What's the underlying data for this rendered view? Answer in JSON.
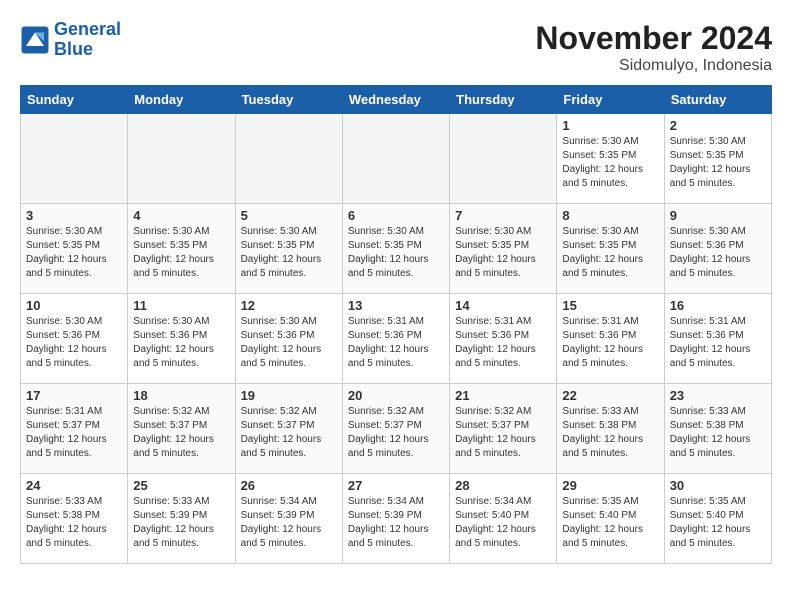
{
  "logo": {
    "line1": "General",
    "line2": "Blue"
  },
  "title": "November 2024",
  "subtitle": "Sidomulyo, Indonesia",
  "days_of_week": [
    "Sunday",
    "Monday",
    "Tuesday",
    "Wednesday",
    "Thursday",
    "Friday",
    "Saturday"
  ],
  "weeks": [
    [
      {
        "day": "",
        "empty": true
      },
      {
        "day": "",
        "empty": true
      },
      {
        "day": "",
        "empty": true
      },
      {
        "day": "",
        "empty": true
      },
      {
        "day": "",
        "empty": true
      },
      {
        "day": "1",
        "sunrise": "Sunrise: 5:30 AM",
        "sunset": "Sunset: 5:35 PM",
        "daylight": "Daylight: 12 hours and 5 minutes."
      },
      {
        "day": "2",
        "sunrise": "Sunrise: 5:30 AM",
        "sunset": "Sunset: 5:35 PM",
        "daylight": "Daylight: 12 hours and 5 minutes."
      }
    ],
    [
      {
        "day": "3",
        "sunrise": "Sunrise: 5:30 AM",
        "sunset": "Sunset: 5:35 PM",
        "daylight": "Daylight: 12 hours and 5 minutes."
      },
      {
        "day": "4",
        "sunrise": "Sunrise: 5:30 AM",
        "sunset": "Sunset: 5:35 PM",
        "daylight": "Daylight: 12 hours and 5 minutes."
      },
      {
        "day": "5",
        "sunrise": "Sunrise: 5:30 AM",
        "sunset": "Sunset: 5:35 PM",
        "daylight": "Daylight: 12 hours and 5 minutes."
      },
      {
        "day": "6",
        "sunrise": "Sunrise: 5:30 AM",
        "sunset": "Sunset: 5:35 PM",
        "daylight": "Daylight: 12 hours and 5 minutes."
      },
      {
        "day": "7",
        "sunrise": "Sunrise: 5:30 AM",
        "sunset": "Sunset: 5:35 PM",
        "daylight": "Daylight: 12 hours and 5 minutes."
      },
      {
        "day": "8",
        "sunrise": "Sunrise: 5:30 AM",
        "sunset": "Sunset: 5:35 PM",
        "daylight": "Daylight: 12 hours and 5 minutes."
      },
      {
        "day": "9",
        "sunrise": "Sunrise: 5:30 AM",
        "sunset": "Sunset: 5:36 PM",
        "daylight": "Daylight: 12 hours and 5 minutes."
      }
    ],
    [
      {
        "day": "10",
        "sunrise": "Sunrise: 5:30 AM",
        "sunset": "Sunset: 5:36 PM",
        "daylight": "Daylight: 12 hours and 5 minutes."
      },
      {
        "day": "11",
        "sunrise": "Sunrise: 5:30 AM",
        "sunset": "Sunset: 5:36 PM",
        "daylight": "Daylight: 12 hours and 5 minutes."
      },
      {
        "day": "12",
        "sunrise": "Sunrise: 5:30 AM",
        "sunset": "Sunset: 5:36 PM",
        "daylight": "Daylight: 12 hours and 5 minutes."
      },
      {
        "day": "13",
        "sunrise": "Sunrise: 5:31 AM",
        "sunset": "Sunset: 5:36 PM",
        "daylight": "Daylight: 12 hours and 5 minutes."
      },
      {
        "day": "14",
        "sunrise": "Sunrise: 5:31 AM",
        "sunset": "Sunset: 5:36 PM",
        "daylight": "Daylight: 12 hours and 5 minutes."
      },
      {
        "day": "15",
        "sunrise": "Sunrise: 5:31 AM",
        "sunset": "Sunset: 5:36 PM",
        "daylight": "Daylight: 12 hours and 5 minutes."
      },
      {
        "day": "16",
        "sunrise": "Sunrise: 5:31 AM",
        "sunset": "Sunset: 5:36 PM",
        "daylight": "Daylight: 12 hours and 5 minutes."
      }
    ],
    [
      {
        "day": "17",
        "sunrise": "Sunrise: 5:31 AM",
        "sunset": "Sunset: 5:37 PM",
        "daylight": "Daylight: 12 hours and 5 minutes."
      },
      {
        "day": "18",
        "sunrise": "Sunrise: 5:32 AM",
        "sunset": "Sunset: 5:37 PM",
        "daylight": "Daylight: 12 hours and 5 minutes."
      },
      {
        "day": "19",
        "sunrise": "Sunrise: 5:32 AM",
        "sunset": "Sunset: 5:37 PM",
        "daylight": "Daylight: 12 hours and 5 minutes."
      },
      {
        "day": "20",
        "sunrise": "Sunrise: 5:32 AM",
        "sunset": "Sunset: 5:37 PM",
        "daylight": "Daylight: 12 hours and 5 minutes."
      },
      {
        "day": "21",
        "sunrise": "Sunrise: 5:32 AM",
        "sunset": "Sunset: 5:37 PM",
        "daylight": "Daylight: 12 hours and 5 minutes."
      },
      {
        "day": "22",
        "sunrise": "Sunrise: 5:33 AM",
        "sunset": "Sunset: 5:38 PM",
        "daylight": "Daylight: 12 hours and 5 minutes."
      },
      {
        "day": "23",
        "sunrise": "Sunrise: 5:33 AM",
        "sunset": "Sunset: 5:38 PM",
        "daylight": "Daylight: 12 hours and 5 minutes."
      }
    ],
    [
      {
        "day": "24",
        "sunrise": "Sunrise: 5:33 AM",
        "sunset": "Sunset: 5:38 PM",
        "daylight": "Daylight: 12 hours and 5 minutes."
      },
      {
        "day": "25",
        "sunrise": "Sunrise: 5:33 AM",
        "sunset": "Sunset: 5:39 PM",
        "daylight": "Daylight: 12 hours and 5 minutes."
      },
      {
        "day": "26",
        "sunrise": "Sunrise: 5:34 AM",
        "sunset": "Sunset: 5:39 PM",
        "daylight": "Daylight: 12 hours and 5 minutes."
      },
      {
        "day": "27",
        "sunrise": "Sunrise: 5:34 AM",
        "sunset": "Sunset: 5:39 PM",
        "daylight": "Daylight: 12 hours and 5 minutes."
      },
      {
        "day": "28",
        "sunrise": "Sunrise: 5:34 AM",
        "sunset": "Sunset: 5:40 PM",
        "daylight": "Daylight: 12 hours and 5 minutes."
      },
      {
        "day": "29",
        "sunrise": "Sunrise: 5:35 AM",
        "sunset": "Sunset: 5:40 PM",
        "daylight": "Daylight: 12 hours and 5 minutes."
      },
      {
        "day": "30",
        "sunrise": "Sunrise: 5:35 AM",
        "sunset": "Sunset: 5:40 PM",
        "daylight": "Daylight: 12 hours and 5 minutes."
      }
    ]
  ]
}
